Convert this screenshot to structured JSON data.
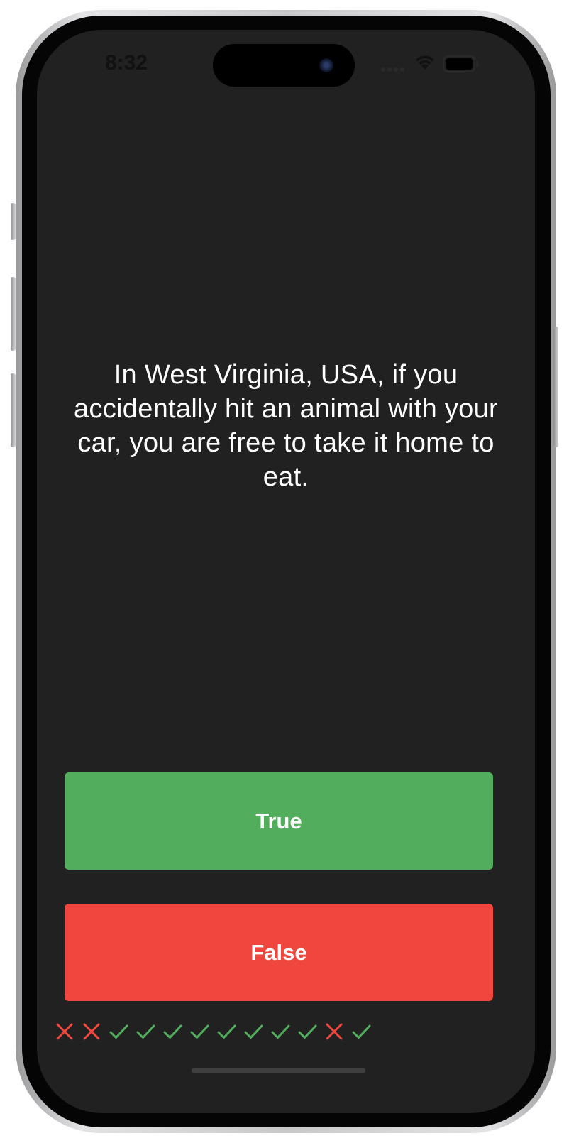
{
  "status_bar": {
    "time": "8:32"
  },
  "question": {
    "text": "In West Virginia, USA, if you accidentally hit an animal with your car, you are free to take it home to eat."
  },
  "buttons": {
    "true_label": "True",
    "false_label": "False"
  },
  "colors": {
    "background": "#212121",
    "true_button": "#52ad5c",
    "false_button": "#ef473e",
    "correct_mark": "#52ad5c",
    "wrong_mark": "#ef473e"
  },
  "score_keeper": [
    {
      "result": "wrong",
      "icon": "close-icon"
    },
    {
      "result": "wrong",
      "icon": "close-icon"
    },
    {
      "result": "correct",
      "icon": "check-icon"
    },
    {
      "result": "correct",
      "icon": "check-icon"
    },
    {
      "result": "correct",
      "icon": "check-icon"
    },
    {
      "result": "correct",
      "icon": "check-icon"
    },
    {
      "result": "correct",
      "icon": "check-icon"
    },
    {
      "result": "correct",
      "icon": "check-icon"
    },
    {
      "result": "correct",
      "icon": "check-icon"
    },
    {
      "result": "correct",
      "icon": "check-icon"
    },
    {
      "result": "wrong",
      "icon": "close-icon"
    },
    {
      "result": "correct",
      "icon": "check-icon"
    }
  ]
}
